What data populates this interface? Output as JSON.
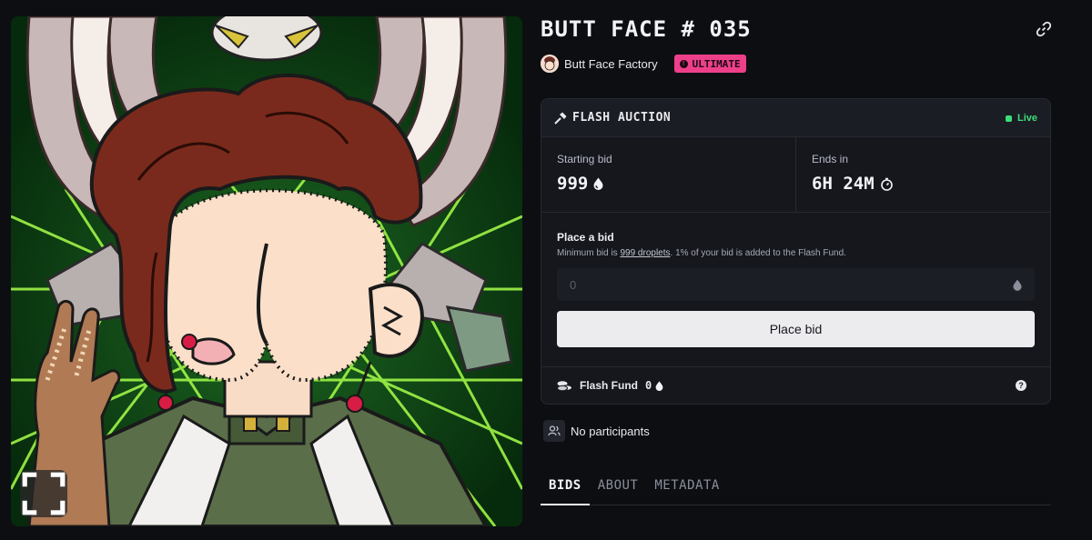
{
  "artwork": {
    "alt": "Butt Face #035 artwork",
    "fullscreen_icon": "expand-icon"
  },
  "nft": {
    "title": "BUTT FACE # 035",
    "link_icon": "link-icon"
  },
  "creator": {
    "name": "Butt Face Factory",
    "badge": "ULTIMATE",
    "badge_color": "#ee3f8a"
  },
  "auction": {
    "header": "FLASH AUCTION",
    "header_icon": "gavel-icon",
    "status": "Live",
    "status_color": "#3ddc7b",
    "starting_bid_label": "Starting bid",
    "starting_bid_value": "999",
    "currency_icon": "droplet-icon",
    "ends_label": "Ends in",
    "ends_value": "6H 24M",
    "timer_icon": "stopwatch-icon"
  },
  "bid": {
    "title": "Place a bid",
    "subtitle_prefix": "Minimum bid is ",
    "subtitle_link": "999 droplets",
    "subtitle_suffix": ". 1% of your bid is added to the Flash Fund.",
    "input_placeholder": "0",
    "button_label": "Place bid"
  },
  "flash_fund": {
    "label": "Flash Fund",
    "value": "0",
    "icon": "coins-icon",
    "help_icon": "question-icon",
    "help_glyph": "?"
  },
  "participants": {
    "text": "No participants",
    "icon": "users-icon"
  },
  "tabs": [
    {
      "label": "BIDS",
      "active": true
    },
    {
      "label": "ABOUT",
      "active": false
    },
    {
      "label": "METADATA",
      "active": false
    }
  ]
}
